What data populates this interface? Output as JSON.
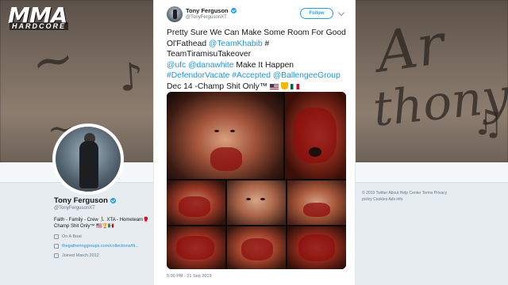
{
  "logo": {
    "main": "MMA",
    "sub": "HARDCORE"
  },
  "background_profile": {
    "name": "Tony Ferguson",
    "handle": "@TonyFergusonXT",
    "bio": "Faith - Family - Crew 🏃‍♂️ XTA - Hometeam🥊 Champ Shit Only™ 🇺🇸🏆🇲🇽",
    "location": "On A Boat",
    "website": "thegatheringgroups.com/collections/fit...",
    "joined": "Joined March 2012",
    "footer": "© 2019 Twitter   About   Help Center   Terms   Privacy policy   Cookies   Ads info",
    "tattoo_text": [
      "Ar",
      "thony"
    ]
  },
  "tweet": {
    "author_name": "Tony Ferguson",
    "author_handle": "@TonyFergusonXT",
    "follow_label": "Follow",
    "text_parts": [
      {
        "text": "Pretty Sure We Can Make Some Room For Good Ol'Fathead ",
        "link": false
      },
      {
        "text": "@TeamKhabib",
        "link": true
      },
      {
        "text": " #",
        "link": false
      },
      {
        "text": "TeamTiramisuTakeover",
        "link": false
      },
      {
        "text": "@ufc",
        "link": true
      },
      {
        "text": " ",
        "link": false
      },
      {
        "text": "@danawhite",
        "link": true
      },
      {
        "text": " Make It Happen ",
        "link": false
      },
      {
        "text": "#DefendorVacate",
        "link": true
      },
      {
        "text": " ",
        "link": false
      },
      {
        "text": "#Accepted",
        "link": true
      },
      {
        "text": " ",
        "link": false
      },
      {
        "text": "@BallengeeGroup",
        "link": true
      },
      {
        "text": " Dec 14 -Champ Shit Only™ ",
        "link": false
      }
    ],
    "timestamp": "5:00 PM - 21 Sep 2019",
    "photo_count": 8
  },
  "colors": {
    "link": "#1b95e0",
    "twitter_blue": "#1da1f2",
    "text": "#14171a",
    "muted": "#657786"
  }
}
